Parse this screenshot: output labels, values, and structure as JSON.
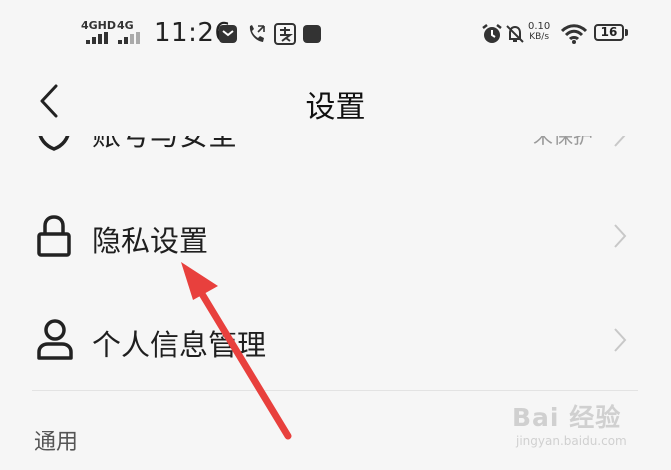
{
  "status_bar": {
    "network_1": "4GHD",
    "network_2": "4G",
    "time": "11:26",
    "speed_value": "0.10",
    "speed_unit": "KB/s",
    "battery": "16"
  },
  "nav": {
    "title": "设置"
  },
  "rows": [
    {
      "label": "账号与安全",
      "value": "未保护"
    },
    {
      "label": "隐私设置"
    },
    {
      "label": "个人信息管理"
    }
  ],
  "section_header": "通用",
  "watermark": {
    "brand": "Bai  经验",
    "url": "jingyan.baidu.com"
  },
  "colors": {
    "arrow": "#e8403d",
    "background": "#f6f6f6"
  },
  "icons": [
    "back-icon",
    "shield-icon",
    "lock-icon",
    "person-icon",
    "chevron-right-icon"
  ]
}
